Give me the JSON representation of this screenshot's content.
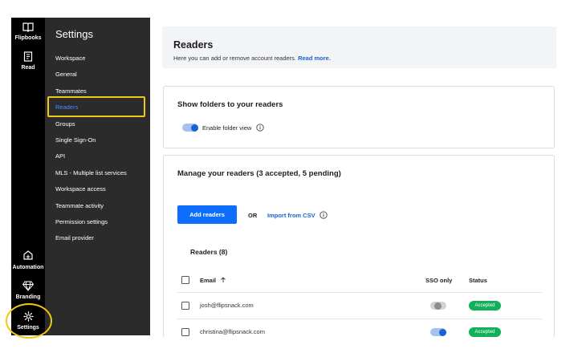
{
  "rail": {
    "items": [
      {
        "label": "Flipbooks",
        "icon": "book-icon"
      },
      {
        "label": "Read",
        "icon": "reader-icon"
      },
      {
        "label": "Automation",
        "icon": "automation-icon"
      },
      {
        "label": "Branding",
        "icon": "diamond-icon"
      },
      {
        "label": "Settings",
        "icon": "gear-icon"
      }
    ]
  },
  "sidebar": {
    "title": "Settings",
    "items": [
      {
        "label": "Workspace"
      },
      {
        "label": "General"
      },
      {
        "label": "Teammates"
      },
      {
        "label": "Readers",
        "active": true
      },
      {
        "label": "Groups"
      },
      {
        "label": "Single Sign-On"
      },
      {
        "label": "API"
      },
      {
        "label": "MLS - Multiple list services"
      },
      {
        "label": "Workspace access"
      },
      {
        "label": "Teammate activity"
      },
      {
        "label": "Permission settings"
      },
      {
        "label": "Email provider"
      }
    ]
  },
  "header": {
    "title": "Readers",
    "subtitle": "Here you can add or remove account readers.",
    "link": "Read more."
  },
  "folders_card": {
    "title": "Show folders to your readers",
    "toggle_label": "Enable folder view",
    "toggle_on": true
  },
  "readers_card": {
    "title": "Manage your readers (3 accepted, 5 pending)",
    "add_button": "Add readers",
    "or_label": "OR",
    "import_link": "Import from CSV",
    "readers_count": "Readers (8)",
    "columns": {
      "email": "Email",
      "sso": "SSO only",
      "status": "Status"
    },
    "rows": [
      {
        "email": "josh@flipsnack.com",
        "sso_only": false,
        "status": "Accepted"
      },
      {
        "email": "christina@flipsnack.com",
        "sso_only": true,
        "status": "Accepted"
      }
    ]
  },
  "colors": {
    "accent": "#0d6efd",
    "link": "#1662d6",
    "highlight": "#f3c614",
    "accepted": "#12b05a",
    "sidebar_bg": "#2b2b2b",
    "rail_bg": "#000000"
  }
}
